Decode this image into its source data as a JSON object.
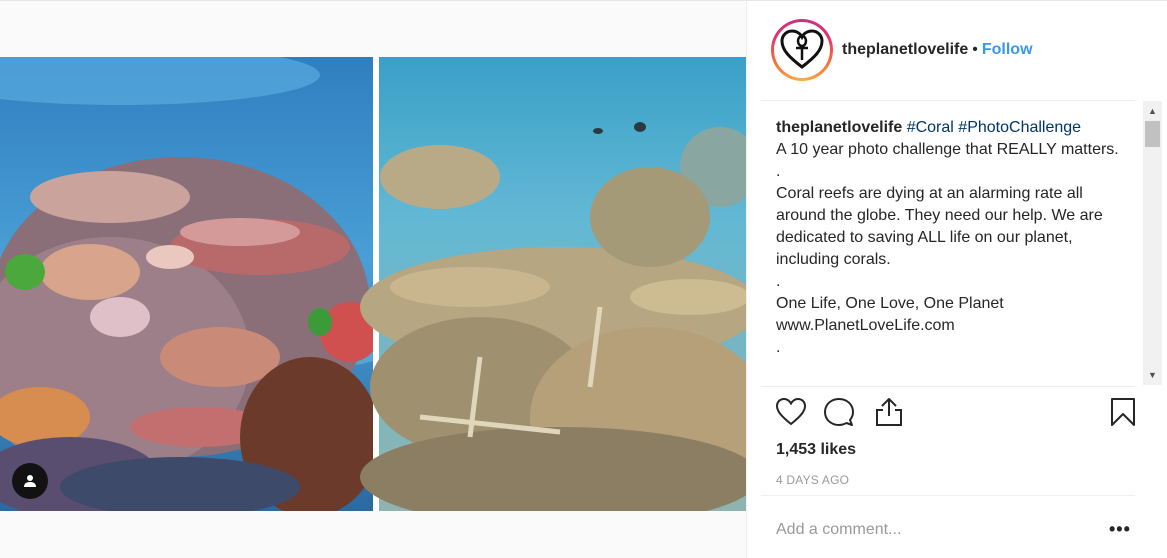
{
  "post": {
    "username": "theplanetlovelife",
    "separator": "•",
    "follow_label": "Follow",
    "caption": {
      "username": "theplanetlovelife",
      "hashtags": [
        "#Coral",
        "#PhotoChallenge"
      ],
      "lines": [
        "A 10 year photo challenge that REALLY matters.",
        ".",
        "Coral reefs are dying at an alarming rate all around the globe. They need our help. We are dedicated to saving ALL life on our planet, including corals.",
        ".",
        "One Life, One Love, One Planet",
        "www.PlanetLoveLife.com",
        "."
      ]
    },
    "likes": "1,453 likes",
    "date": "4 DAYS AGO",
    "comment_placeholder": "Add a comment...",
    "more_label": "•••"
  },
  "icons": {
    "like": "heart-icon",
    "comment": "comment-icon",
    "share": "share-icon",
    "save": "bookmark-icon",
    "tagged_user": "user-icon",
    "scroll_up": "▲",
    "scroll_down": "▼"
  },
  "colors": {
    "follow": "#3897f0",
    "hashtag": "#003569",
    "muted": "#999999",
    "text": "#262626"
  }
}
